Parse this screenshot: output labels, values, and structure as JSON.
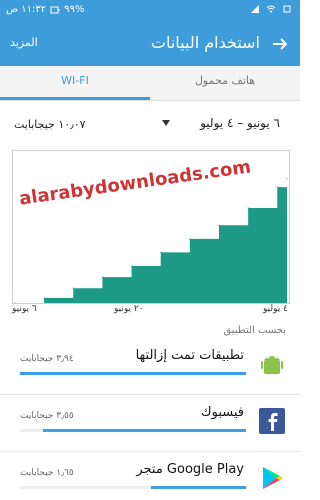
{
  "status_bar": {
    "time": "١١:٣٢ ص",
    "battery_percent": "٩٩%"
  },
  "header": {
    "title": "استخدام البيانات",
    "more_label": "المزيد"
  },
  "tabs": {
    "wifi_label": "WI-FI",
    "mobile_label": "هاتف محمول",
    "active": "WI-FI"
  },
  "range": {
    "label": "٦ يونيو – ٤ يوليو",
    "total_usage": "١٠٫٠٧ جيجابايت"
  },
  "chart_data": {
    "type": "area",
    "title": "",
    "xlabel": "",
    "ylabel": "",
    "tick_labels": [
      "٦ يونيو",
      "٢٠ يونيو",
      "٤ يوليو"
    ],
    "x": [
      0,
      3,
      6,
      9,
      12,
      15,
      18,
      21,
      24,
      27,
      28
    ],
    "y": [
      0,
      0.42,
      1.2,
      2.1,
      3.0,
      4.1,
      5.2,
      6.3,
      7.7,
      9.4,
      10.07
    ],
    "ylim": [
      0,
      12
    ],
    "grid": false,
    "color": "#1c9a86"
  },
  "section_header": "بحسب التطبيق",
  "apps": [
    {
      "name": "تطبيقات تمت إزالتها",
      "size": "٣٫٩٤ جيجابايت",
      "fraction": 1.0,
      "icon": "android-icon"
    },
    {
      "name": "فيسبوك",
      "size": "٣٫٥٥ جيجابايت",
      "fraction": 0.9,
      "icon": "facebook-icon"
    },
    {
      "name": "متجر Google Play",
      "size": "١٫٦٥ جيجابايت",
      "fraction": 0.42,
      "icon": "play-store-icon"
    }
  ],
  "watermark": "alarabydownloads.com",
  "colors": {
    "primary": "#3d9cd9",
    "accent": "#3da0e6",
    "chart_fill": "#1c9a86"
  }
}
